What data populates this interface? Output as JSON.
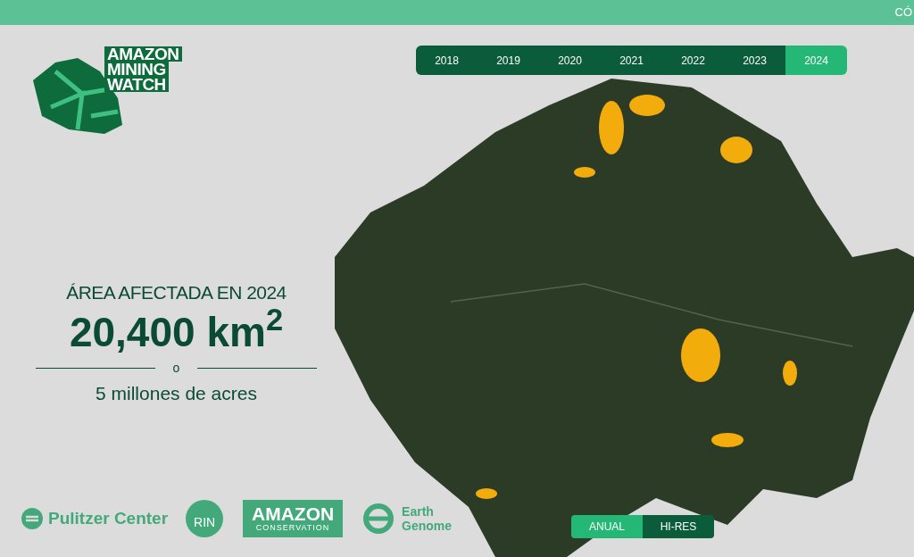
{
  "top_bar": {
    "text": "CÓ"
  },
  "logo": {
    "lines": [
      "AMAZON",
      "MINING",
      "WATCH"
    ]
  },
  "year_tabs": [
    {
      "label": "2018",
      "selected": false
    },
    {
      "label": "2019",
      "selected": false
    },
    {
      "label": "2020",
      "selected": false
    },
    {
      "label": "2021",
      "selected": false
    },
    {
      "label": "2022",
      "selected": false
    },
    {
      "label": "2023",
      "selected": false
    },
    {
      "label": "2024",
      "selected": true
    }
  ],
  "stats": {
    "title": "ÁREA AFECTADA EN 2024",
    "value": "20,400 km$^{2}$",
    "separator": "o",
    "subtitle": "5 millones de acres"
  },
  "partners": [
    {
      "kind": "pulitzer",
      "texts": [
        "Pulitzer Center"
      ]
    },
    {
      "kind": "rin",
      "texts": [
        "RIN"
      ]
    },
    {
      "kind": "amazon",
      "texts": [
        "AMAZON",
        "CONSERVATION"
      ]
    },
    {
      "kind": "earth",
      "texts": [
        "Earth",
        "Genome"
      ]
    }
  ],
  "view_toggle": [
    {
      "label": "ANUAL",
      "selected": true
    },
    {
      "label": "HI-RES",
      "selected": false
    }
  ]
}
